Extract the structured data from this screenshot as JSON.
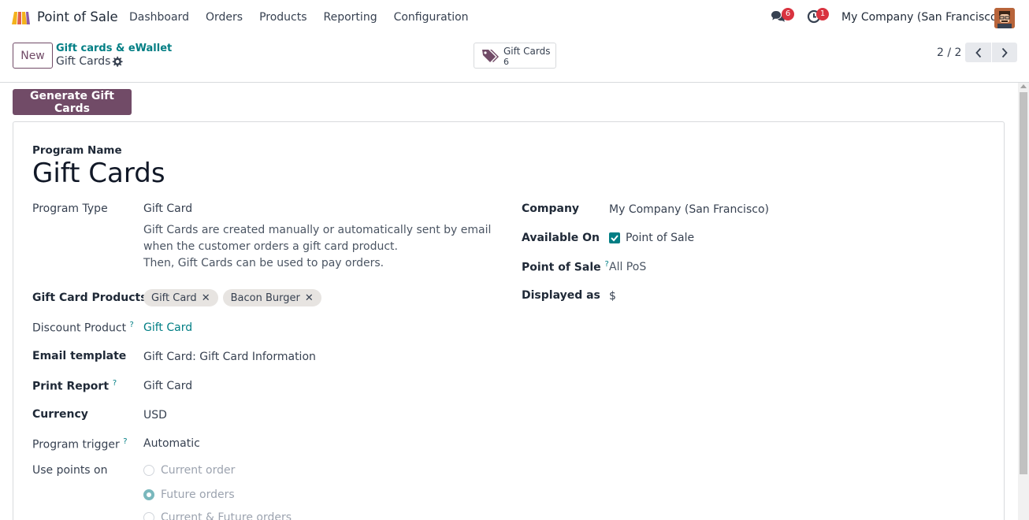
{
  "navbar": {
    "app_name": "Point of Sale",
    "menu": [
      "Dashboard",
      "Orders",
      "Products",
      "Reporting",
      "Configuration"
    ],
    "chat_count": "6",
    "activity_count": "1",
    "company": "My Company (San Francisco)"
  },
  "control": {
    "new_label": "New",
    "breadcrumb_parent": "Gift cards & eWallet",
    "breadcrumb_current": "Gift Cards",
    "smart_button_label": "Gift Cards",
    "smart_button_value": "6",
    "pager": "2 / 2"
  },
  "actions": {
    "generate_label": "Generate Gift Cards"
  },
  "form": {
    "program_name_label": "Program Name",
    "program_name": "Gift Cards",
    "left": {
      "program_type_label": "Program Type",
      "program_type": "Gift Card",
      "description_line1": "Gift Cards are created manually or automatically sent by email when the customer orders a gift card product.",
      "description_line2": "Then, Gift Cards can be used to pay orders.",
      "gift_card_products_label": "Gift Card Products",
      "gift_card_products": [
        "Gift Card",
        "Bacon Burger"
      ],
      "discount_product_label": "Discount Product",
      "discount_product": "Gift Card",
      "email_template_label": "Email template",
      "email_template": "Gift Card: Gift Card Information",
      "print_report_label": "Print Report",
      "print_report": "Gift Card",
      "currency_label": "Currency",
      "currency": "USD",
      "program_trigger_label": "Program trigger",
      "program_trigger": "Automatic",
      "use_points_on_label": "Use points on",
      "use_points_options": [
        "Current order",
        "Future orders",
        "Current & Future orders"
      ],
      "use_points_selected": "Future orders"
    },
    "right": {
      "company_label": "Company",
      "company": "My Company (San Francisco)",
      "available_on_label": "Available On",
      "available_on": "Point of Sale",
      "point_of_sale_label": "Point of Sale",
      "point_of_sale": "All PoS",
      "displayed_as_label": "Displayed as",
      "displayed_as": "$"
    },
    "help_marker": "?"
  },
  "colors": {
    "brand": "#714b67",
    "link": "#017e84",
    "badge": "#d9333f"
  }
}
